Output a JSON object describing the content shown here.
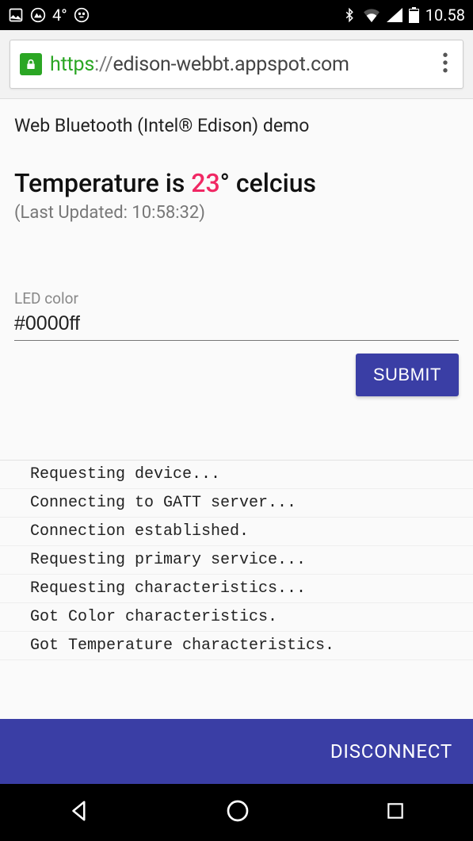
{
  "status": {
    "temp": "4°",
    "time": "10.58"
  },
  "browser": {
    "scheme": "https",
    "sep": "://",
    "host": "edison-webbt.appspot.com"
  },
  "page": {
    "title": "Web Bluetooth (Intel® Edison) demo",
    "temperature": {
      "prefix": "Temperature is ",
      "value": "23",
      "suffix": "° celcius"
    },
    "updated_prefix": "(Last Updated: ",
    "updated_time": "10:58:32",
    "updated_suffix": ")",
    "led": {
      "label": "LED color",
      "value": "#0000ff"
    },
    "submit_label": "SUBMIT",
    "disconnect_label": "DISCONNECT",
    "log": [
      "Requesting device...",
      "Connecting to GATT server...",
      "Connection established.",
      "Requesting primary service...",
      "Requesting characteristics...",
      "Got Color characteristics.",
      "Got Temperature characteristics."
    ]
  },
  "colors": {
    "accent": "#3a3ea5",
    "highlight": "#f02864",
    "secure": "#2ba624"
  }
}
